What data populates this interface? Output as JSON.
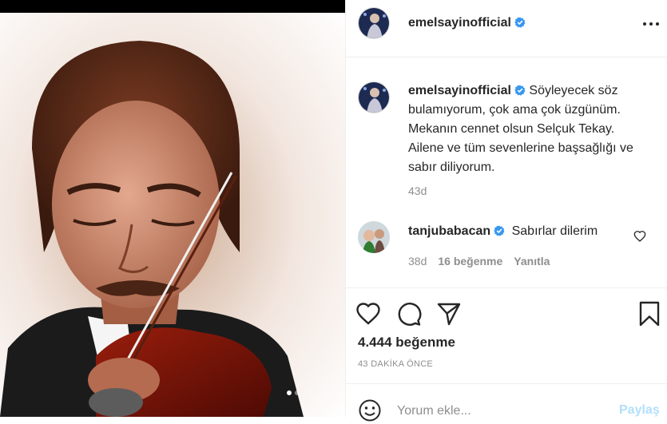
{
  "post": {
    "username": "emelsayinofficial",
    "more_icon": "more-options-icon"
  },
  "caption": {
    "username": "emelsayinofficial",
    "text": "Söyleyecek söz bulamıyorum, çok ama çok üzgünüm. Mekanın cennet olsun Selçuk Tekay. Ailene ve tüm sevenlerine başsağlığı ve sabır diliyorum.",
    "time": "43d"
  },
  "comment": {
    "username": "tanjubabacan",
    "text": "Sabırlar dilerim",
    "time": "38d",
    "likes": "16 beğenme",
    "reply": "Yanıtla"
  },
  "actions": {
    "icons": [
      "heart-icon",
      "comment-icon",
      "share-icon",
      "bookmark-icon"
    ]
  },
  "likes_text": "4.444 beğenme",
  "post_date": "43 DAKİKA ÖNCE",
  "comment_box": {
    "placeholder": "Yorum ekle...",
    "submit_label": "Paylaş"
  },
  "colors": {
    "verified": "#3897f0",
    "submit_disabled": "#b2dffc",
    "muted_text": "#8e8e8e"
  },
  "carousel": {
    "total": 2,
    "active": 1
  }
}
